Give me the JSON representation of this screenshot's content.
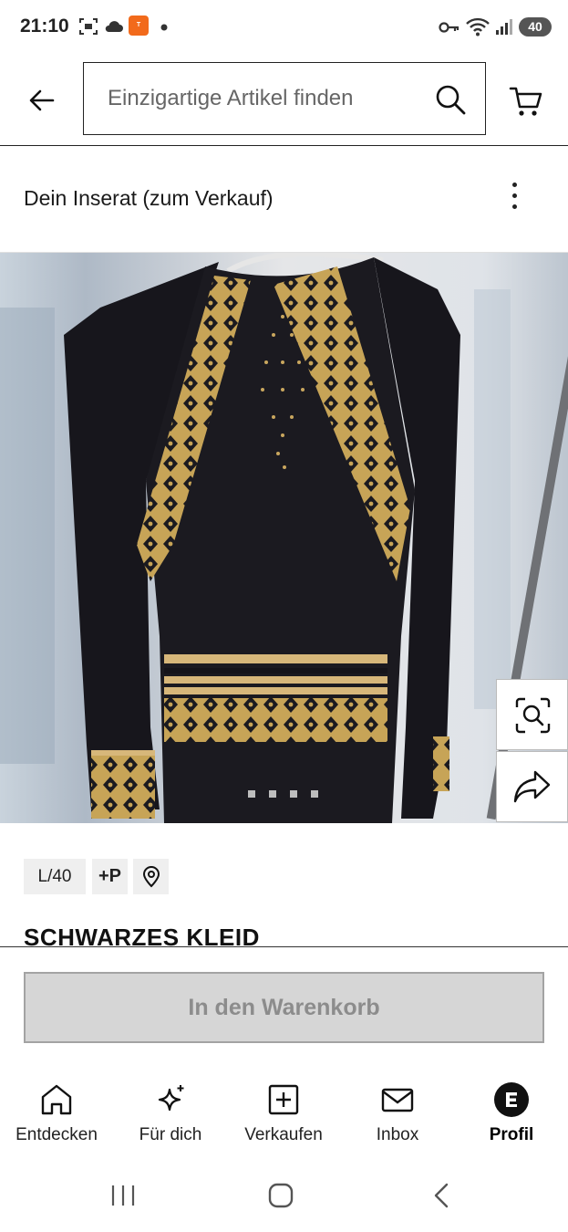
{
  "status_bar": {
    "time": "21:10",
    "battery": "40",
    "icons": [
      "screenshot-icon",
      "cloud-icon",
      "temu-icon",
      "key-icon",
      "wifi-icon",
      "signal-icon"
    ]
  },
  "header": {
    "search_placeholder": "Einzigartige Artikel finden",
    "icons": [
      "back-arrow-icon",
      "search-icon",
      "cart-icon"
    ]
  },
  "listing": {
    "title": "Dein Inserat (zum Verkauf)",
    "menu_icon": "more-vertical-icon"
  },
  "gallery": {
    "image_count": 4,
    "current_index": 1,
    "side_actions": [
      "visual-search-icon",
      "share-icon"
    ]
  },
  "product": {
    "size": "L/40",
    "shipping_badge": "+P",
    "location_icon": "location-pin-icon",
    "title": "SCHWARZES KLEID"
  },
  "actions": {
    "add_to_cart": "In den Warenkorb"
  },
  "bottom_nav": {
    "items": [
      {
        "label": "Entdecken",
        "icon": "home-icon",
        "active": false
      },
      {
        "label": "Für dich",
        "icon": "sparkle-icon",
        "active": false
      },
      {
        "label": "Verkaufen",
        "icon": "plus-square-icon",
        "active": false
      },
      {
        "label": "Inbox",
        "icon": "mail-icon",
        "active": false
      },
      {
        "label": "Profil",
        "icon": "profile-avatar-icon",
        "active": true
      }
    ]
  },
  "system_nav": [
    "recents-icon",
    "home-button-icon",
    "back-icon"
  ],
  "colors": {
    "text": "#111111",
    "disabled_button_bg": "#d6d6d6",
    "disabled_button_text": "#8c8c8c",
    "dress": "#17161c",
    "embroidery_gold": "#c9a75e",
    "temu_orange": "#f26a1b"
  }
}
